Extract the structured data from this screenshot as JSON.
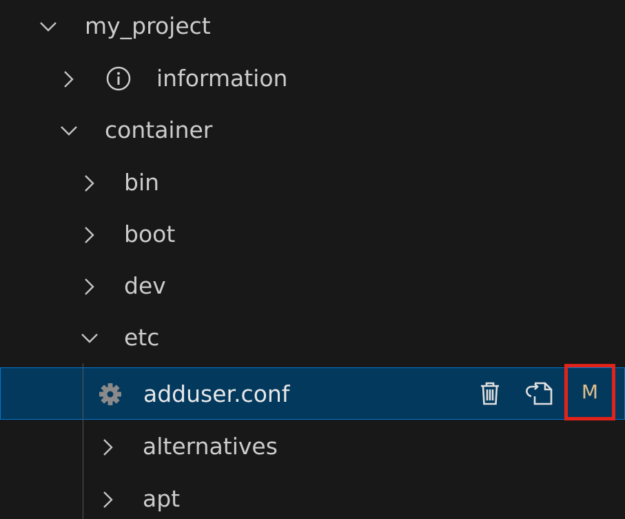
{
  "explorer": {
    "root": {
      "label": "my_project",
      "state": "expanded"
    },
    "items": [
      {
        "label": "information",
        "state": "collapsed",
        "icon": "info-icon"
      },
      {
        "label": "container",
        "state": "expanded"
      },
      {
        "label": "bin",
        "state": "collapsed"
      },
      {
        "label": "boot",
        "state": "collapsed"
      },
      {
        "label": "dev",
        "state": "collapsed"
      },
      {
        "label": "etc",
        "state": "expanded"
      },
      {
        "label": "adduser.conf",
        "icon": "gear-icon",
        "selected": true,
        "git_status": "M"
      },
      {
        "label": "alternatives",
        "state": "collapsed"
      },
      {
        "label": "apt",
        "state": "collapsed"
      }
    ],
    "actions": {
      "delete_icon": "trash-icon",
      "open_icon": "open-file-icon"
    }
  },
  "colors": {
    "background": "#181818",
    "text": "#cccccc",
    "selection_bg": "#04395e",
    "selection_border": "#0078d4",
    "modified_badge": "#e2c08d",
    "highlight_box": "#e2231a"
  }
}
